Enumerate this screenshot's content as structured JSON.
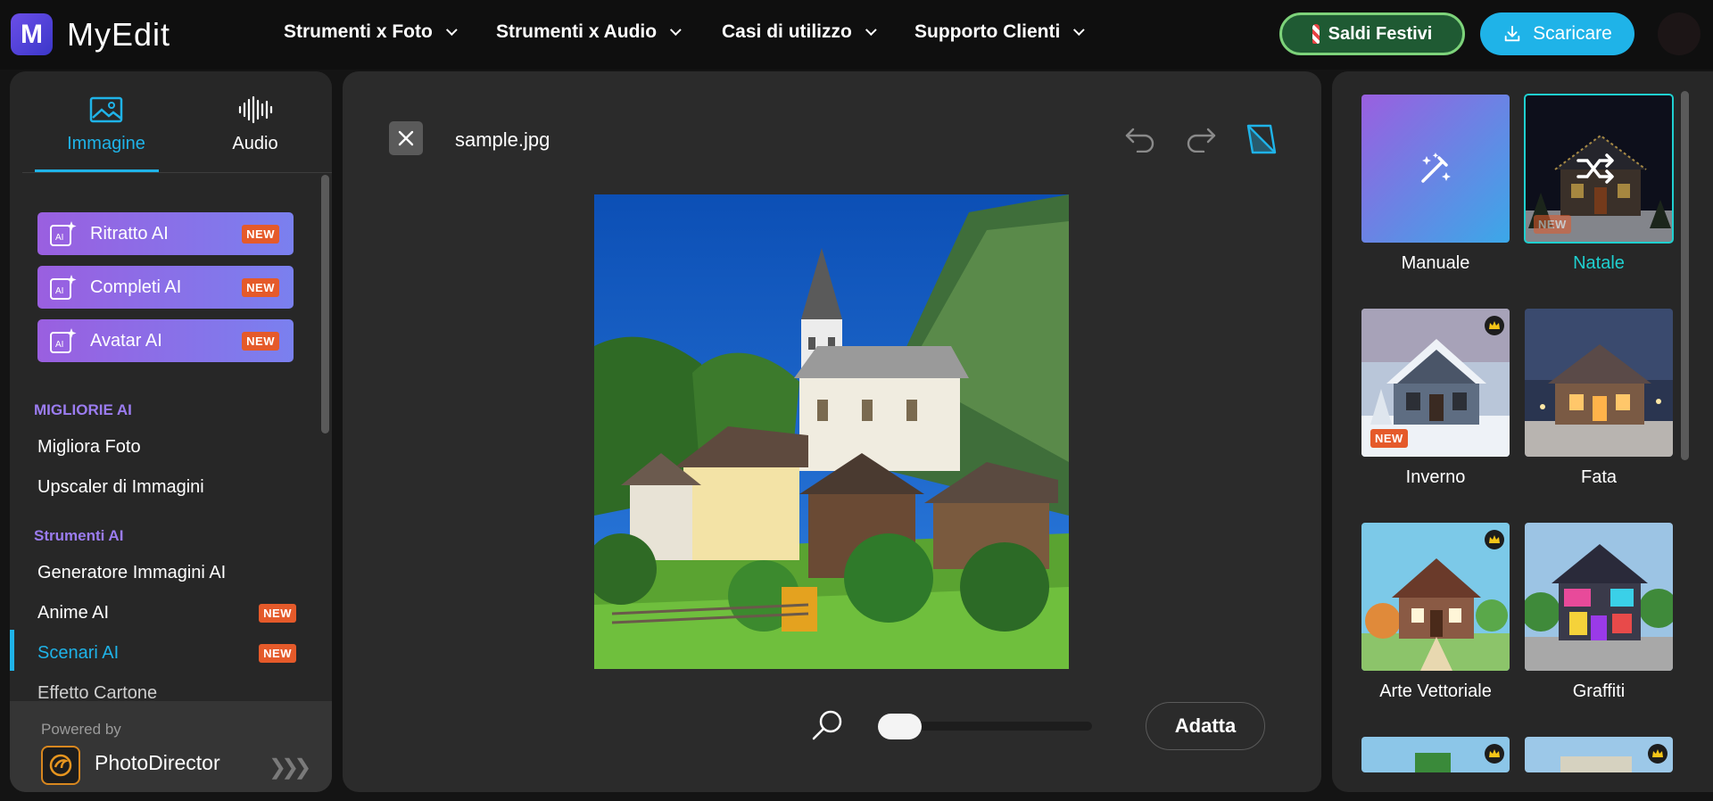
{
  "brand": {
    "name": "MyEdit",
    "logo_letter": "M"
  },
  "nav": {
    "items": [
      {
        "label": "Strumenti x Foto"
      },
      {
        "label": "Strumenti x Audio"
      },
      {
        "label": "Casi di utilizzo"
      },
      {
        "label": "Supporto Clienti"
      }
    ],
    "promo_label": "Saldi Festivi",
    "download_label": "Scaricare"
  },
  "sidebar": {
    "tabs": [
      {
        "label": "Immagine",
        "icon": "image-icon",
        "active": true
      },
      {
        "label": "Audio",
        "icon": "waveform-icon",
        "active": false
      }
    ],
    "ai_buttons": [
      {
        "label": "Ritratto AI",
        "badge": "NEW"
      },
      {
        "label": "Completi AI",
        "badge": "NEW"
      },
      {
        "label": "Avatar AI",
        "badge": "NEW"
      }
    ],
    "sections": [
      {
        "title": "MIGLIORIE AI",
        "title_color": "#9b7cf0",
        "items": [
          {
            "label": "Migliora Foto",
            "badge": ""
          },
          {
            "label": "Upscaler di Immagini",
            "badge": ""
          }
        ]
      },
      {
        "title": "Strumenti AI",
        "title_color": "#9b7cf0",
        "items": [
          {
            "label": "Generatore Immagini AI",
            "badge": ""
          },
          {
            "label": "Anime AI",
            "badge": "NEW"
          },
          {
            "label": "Scenari AI",
            "badge": "NEW",
            "active": true
          },
          {
            "label": "Effetto Cartone",
            "badge": ""
          }
        ]
      }
    ],
    "powered_by": "Powered by",
    "partner_name": "PhotoDirector"
  },
  "editor": {
    "filename": "sample.jpg",
    "fit_label": "Adatta",
    "zoom_level": 0.0
  },
  "styles": [
    {
      "label": "Manuale",
      "badge": "",
      "premium": false,
      "selected": false
    },
    {
      "label": "Natale",
      "badge": "NEW",
      "premium": false,
      "selected": true
    },
    {
      "label": "Inverno",
      "badge": "NEW",
      "premium": true,
      "selected": false
    },
    {
      "label": "Fata",
      "badge": "",
      "premium": false,
      "selected": false
    },
    {
      "label": "Arte Vettoriale",
      "badge": "",
      "premium": true,
      "selected": false
    },
    {
      "label": "Graffiti",
      "badge": "",
      "premium": false,
      "selected": false
    },
    {
      "label": "",
      "badge": "",
      "premium": true,
      "selected": false
    },
    {
      "label": "",
      "badge": "",
      "premium": true,
      "selected": false
    }
  ],
  "colors": {
    "accent": "#1fb3e8",
    "selected": "#1fd0d0",
    "promo_bg": "#1f5a33",
    "new_badge": "#e55a2a"
  }
}
